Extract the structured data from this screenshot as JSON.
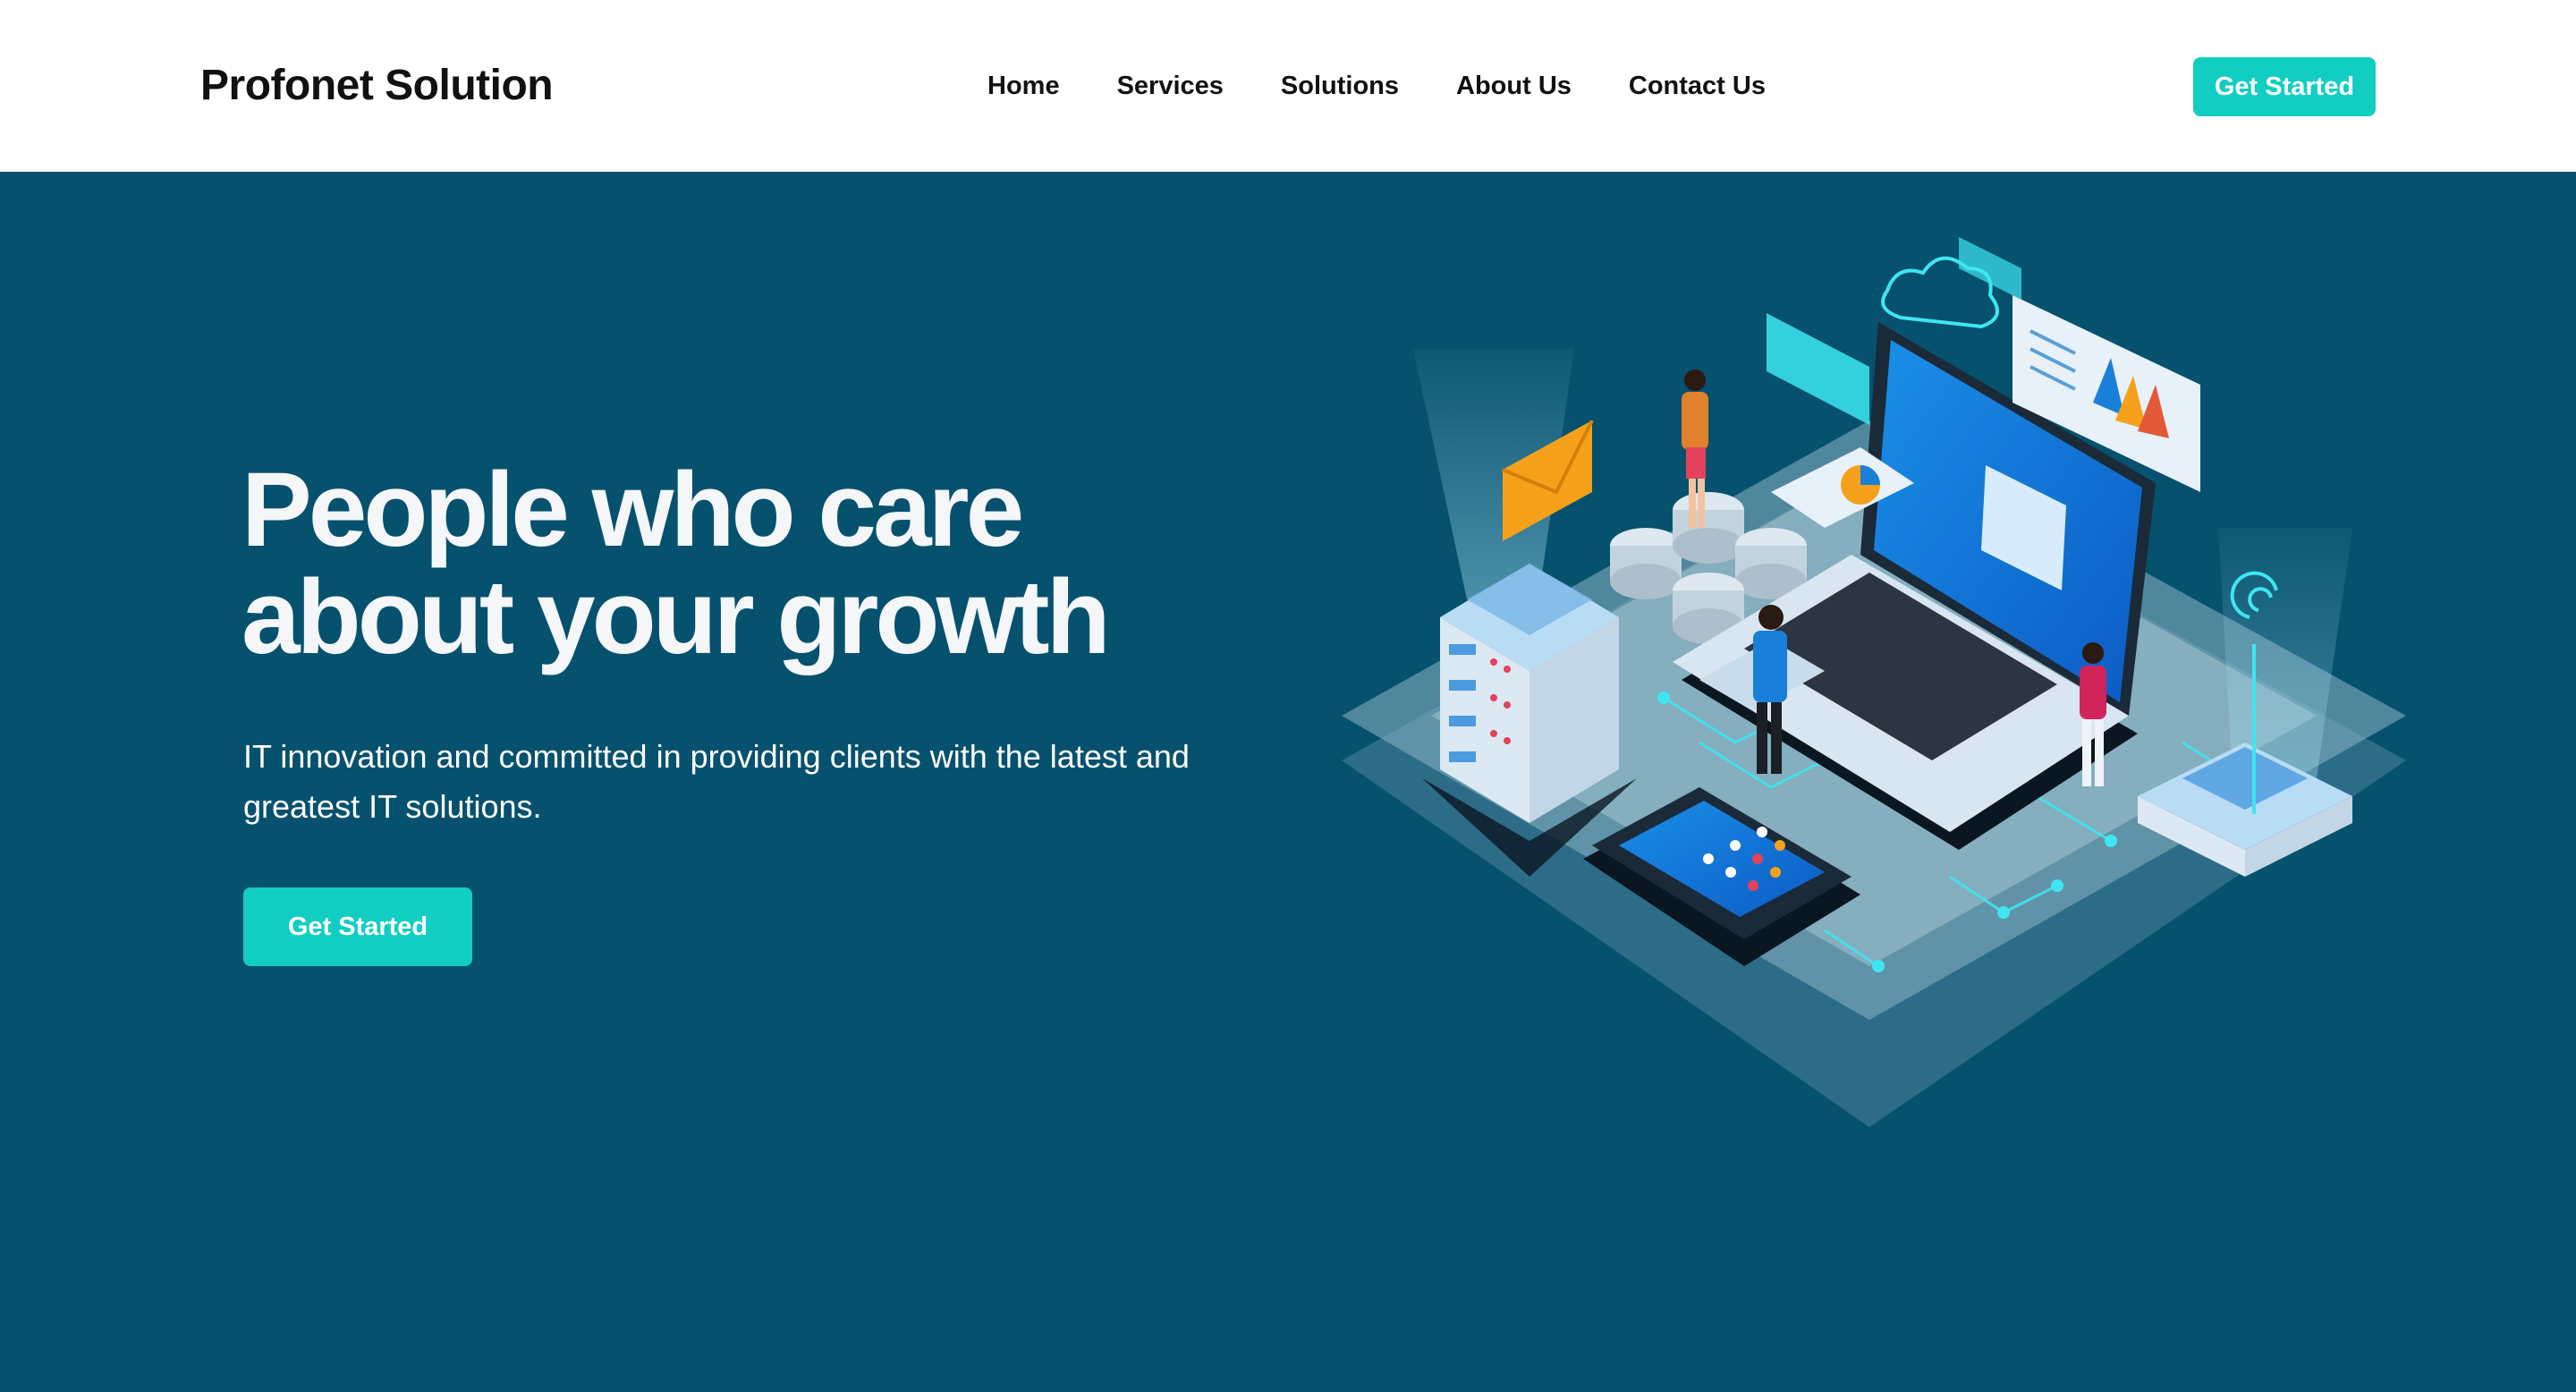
{
  "header": {
    "brand": "Profonet Solution",
    "nav": [
      "Home",
      "Services",
      "Solutions",
      "About Us",
      "Contact Us"
    ],
    "cta_label": "Get Started"
  },
  "hero": {
    "title_line1": "People who care",
    "title_line2": "about your growth",
    "subtitle": "IT innovation and committed in providing clients with the latest and greatest IT solutions.",
    "cta_label": "Get Started"
  },
  "colors": {
    "background": "#06516e",
    "accent": "#12cdc2",
    "nav_bg": "#ffffff"
  },
  "icons": [
    "isometric-it-illustration",
    "laptop-icon",
    "server-icon",
    "smartphone-icon",
    "cloud-icon",
    "envelope-icon",
    "wifi-icon",
    "chart-icon"
  ]
}
